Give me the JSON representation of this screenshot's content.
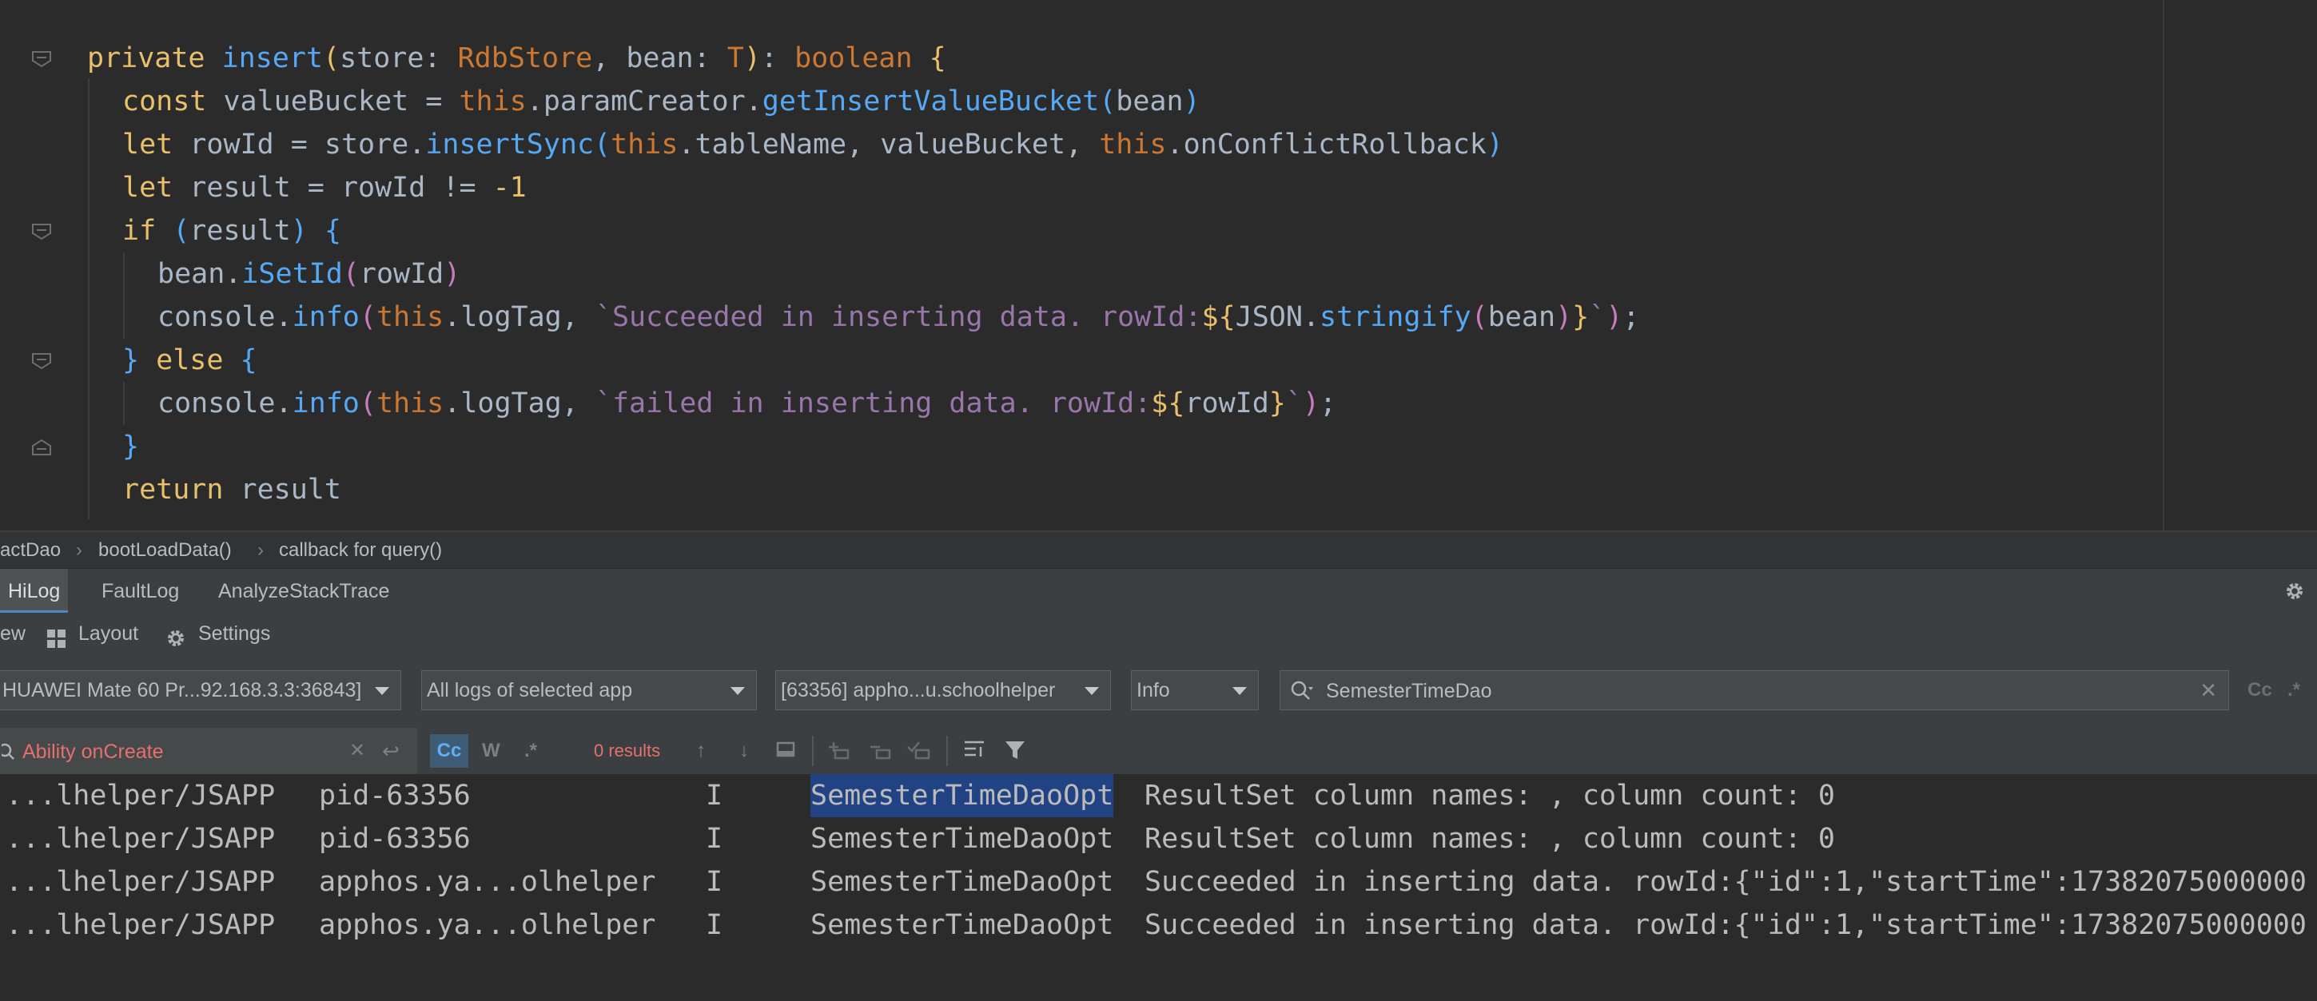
{
  "editor": {
    "lines": [
      [
        {
          "t": "private ",
          "c": "kwy"
        },
        {
          "t": "insert",
          "c": "fn"
        },
        {
          "t": "(",
          "c": "p1"
        },
        {
          "t": "store: "
        },
        {
          "t": "RdbStore",
          "c": "ty"
        },
        {
          "t": ", bean: "
        },
        {
          "t": "T",
          "c": "ty"
        },
        {
          "t": ")",
          "c": "p1"
        },
        {
          "t": ": "
        },
        {
          "t": "boolean ",
          "c": "kw"
        },
        {
          "t": "{",
          "c": "p1"
        }
      ],
      [
        {
          "t": "const ",
          "c": "kwy"
        },
        {
          "t": "valueBucket = "
        },
        {
          "t": "this",
          "c": "th"
        },
        {
          "t": ".paramCreator."
        },
        {
          "t": "getInsertValueBucket",
          "c": "fn"
        },
        {
          "t": "(",
          "c": "p2"
        },
        {
          "t": "bean"
        },
        {
          "t": ")",
          "c": "p2"
        }
      ],
      [
        {
          "t": "let ",
          "c": "kwy"
        },
        {
          "t": "rowId = store."
        },
        {
          "t": "insertSync",
          "c": "fn"
        },
        {
          "t": "(",
          "c": "p2"
        },
        {
          "t": "this",
          "c": "th"
        },
        {
          "t": ".tableName, valueBucket, "
        },
        {
          "t": "this",
          "c": "th"
        },
        {
          "t": ".onConflictRollback"
        },
        {
          "t": ")",
          "c": "p2"
        }
      ],
      [
        {
          "t": "let ",
          "c": "kwy"
        },
        {
          "t": "result = rowId != "
        },
        {
          "t": "-1",
          "c": "kwy"
        }
      ],
      [
        {
          "t": "if ",
          "c": "kwy"
        },
        {
          "t": "(",
          "c": "p2"
        },
        {
          "t": "result"
        },
        {
          "t": ")",
          "c": "p2"
        },
        {
          "t": " "
        },
        {
          "t": "{",
          "c": "p2"
        }
      ],
      [
        {
          "t": "bean."
        },
        {
          "t": "iSetId",
          "c": "fn"
        },
        {
          "t": "(",
          "c": "p3"
        },
        {
          "t": "rowId"
        },
        {
          "t": ")",
          "c": "p3"
        }
      ],
      [
        {
          "t": "console."
        },
        {
          "t": "info",
          "c": "fn"
        },
        {
          "t": "(",
          "c": "p3"
        },
        {
          "t": "this",
          "c": "th"
        },
        {
          "t": ".logTag, "
        },
        {
          "t": "`Succeeded in inserting data. rowId:",
          "c": "str"
        },
        {
          "t": "${",
          "c": "tmpl"
        },
        {
          "t": "JSON."
        },
        {
          "t": "stringify",
          "c": "fn"
        },
        {
          "t": "(",
          "c": "p3"
        },
        {
          "t": "bean"
        },
        {
          "t": ")",
          "c": "p3"
        },
        {
          "t": "}",
          "c": "tmpl"
        },
        {
          "t": "`",
          "c": "str"
        },
        {
          "t": ")",
          "c": "p3"
        },
        {
          "t": ";"
        }
      ],
      [
        {
          "t": "} ",
          "c": "p2"
        },
        {
          "t": "else ",
          "c": "kwy"
        },
        {
          "t": "{",
          "c": "p2"
        }
      ],
      [
        {
          "t": "console."
        },
        {
          "t": "info",
          "c": "fn"
        },
        {
          "t": "(",
          "c": "p3"
        },
        {
          "t": "this",
          "c": "th"
        },
        {
          "t": ".logTag, "
        },
        {
          "t": "`failed in inserting data. rowId:",
          "c": "str"
        },
        {
          "t": "${",
          "c": "tmpl"
        },
        {
          "t": "rowId"
        },
        {
          "t": "}",
          "c": "tmpl"
        },
        {
          "t": "`",
          "c": "str"
        },
        {
          "t": ")",
          "c": "p3"
        },
        {
          "t": ";"
        }
      ],
      [
        {
          "t": "}",
          "c": "p2"
        }
      ],
      [
        {
          "t": "return ",
          "c": "kwy"
        },
        {
          "t": "result"
        }
      ]
    ]
  },
  "breadcrumb": {
    "items": [
      "actDao",
      "bootLoadData()",
      "callback for query()"
    ],
    "separator": "›"
  },
  "tool_tabs": {
    "items": [
      "HiLog",
      "FaultLog",
      "AnalyzeStackTrace"
    ],
    "active": "HiLog"
  },
  "toolbar": {
    "view_label": "ew",
    "layout_label": "Layout",
    "settings_label": "Settings"
  },
  "filters": {
    "device": "HUAWEI Mate 60 Pr...92.168.3.3:36843]",
    "log_scope": "All logs of selected app",
    "process": "[63356] appho...u.schoolhelper",
    "level": "Info",
    "search_value": "SemesterTimeDao",
    "case_label": "Cc",
    "regex_label": ".*"
  },
  "subbar": {
    "ability_filter": "Ability onCreate",
    "cc_label": "Cc",
    "w_label": "W",
    "regex_label": ".*",
    "results": "0 results"
  },
  "log": {
    "rows": [
      {
        "tag": "...lhelper/JSAPP",
        "pid": "pid-63356",
        "level": "I",
        "domain": "SemesterTimeDaoOpt",
        "message": "ResultSet column names: , column count: 0",
        "highlight": true
      },
      {
        "tag": "...lhelper/JSAPP",
        "pid": "pid-63356",
        "level": "I",
        "domain": "SemesterTimeDaoOpt",
        "message": "ResultSet column names: , column count: 0",
        "highlight": false
      },
      {
        "tag": "...lhelper/JSAPP",
        "pid": "apphos.ya...olhelper",
        "level": "I",
        "domain": "SemesterTimeDaoOpt",
        "message": "Succeeded in inserting data. rowId:{\"id\":1,\"startTime\":17382075000000",
        "highlight": false
      },
      {
        "tag": "...lhelper/JSAPP",
        "pid": "apphos.ya...olhelper",
        "level": "I",
        "domain": "SemesterTimeDaoOpt",
        "message": "Succeeded in inserting data. rowId:{\"id\":1,\"startTime\":17382075000000",
        "highlight": false
      }
    ]
  }
}
